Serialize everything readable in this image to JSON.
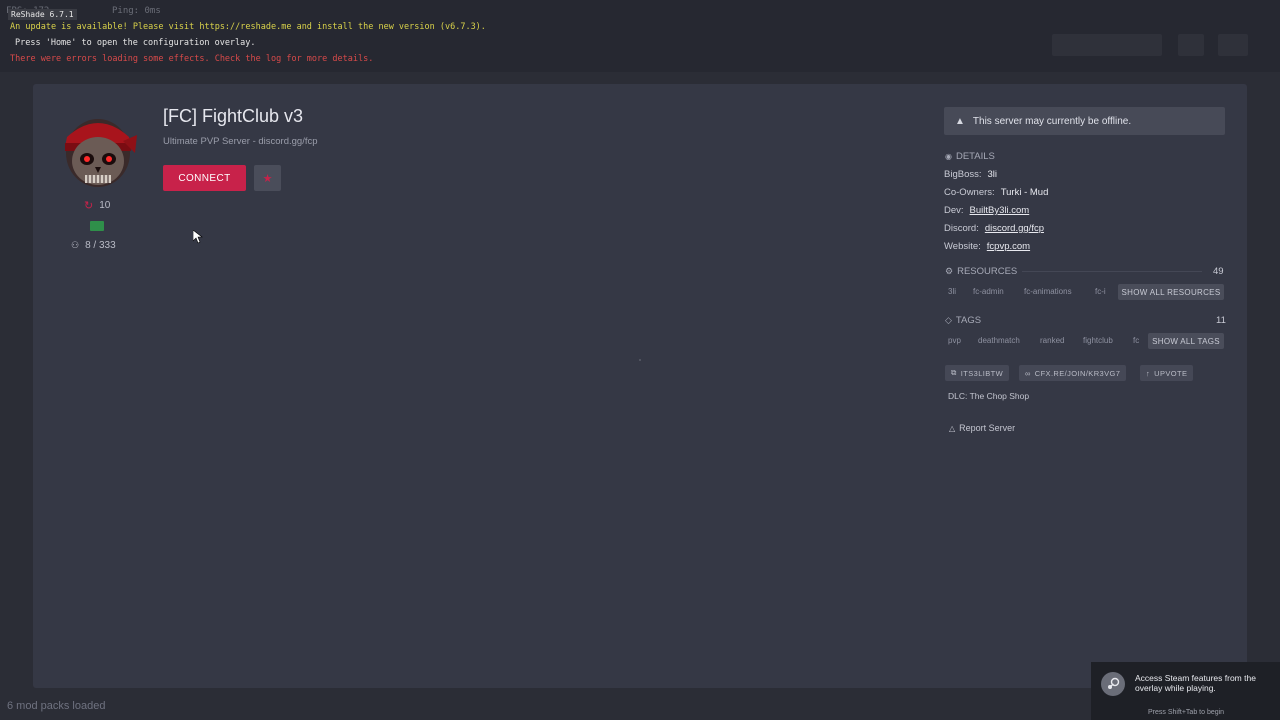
{
  "overlay": {
    "fps": "FPS: 172",
    "ping": "Ping: 0ms",
    "reshade_version": "ReShade 6.7.1",
    "update_notice": "An update is available! Please visit https://reshade.me and install the new version (v6.7.3).",
    "config_hint": "Press 'Home' to open the configuration overlay.",
    "error_notice": "There were errors loading some effects. Check the log for more details.",
    "colors": {
      "update": "#d9d24a",
      "hint": "#e6e6e6",
      "error": "#d84a4a"
    }
  },
  "server": {
    "title": "[FC] FightClub v3",
    "subtitle": "Ultimate PVP Server - discord.gg/fcp",
    "connect_label": "CONNECT",
    "boosts": "10",
    "players": "8 / 333",
    "accent": "#c8224a"
  },
  "status": {
    "offline_message": "This server may currently be offline."
  },
  "details": {
    "heading": "DETAILS",
    "rows": [
      {
        "key": "BigBoss:",
        "value": "3li"
      },
      {
        "key": "Co-Owners:",
        "value": "Turki - Mud"
      },
      {
        "key": "Dev:",
        "value": "BuiltBy3li.com"
      },
      {
        "key": "Discord:",
        "value": "discord.gg/fcp"
      },
      {
        "key": "Website:",
        "value": "fcpvp.com"
      }
    ]
  },
  "resources": {
    "heading": "RESOURCES",
    "count": "49",
    "items": [
      "3li",
      "fc-admin",
      "fc-animations",
      "fc-i"
    ],
    "show_all": "SHOW ALL RESOURCES"
  },
  "tags": {
    "heading": "TAGS",
    "count": "11",
    "items": [
      "pvp",
      "deathmatch",
      "ranked",
      "fightclub",
      "fc"
    ],
    "show_all": "SHOW ALL TAGS"
  },
  "actions": {
    "code": "ITS3LIBTW",
    "join_link": "CFX.RE/JOIN/KR3VG7",
    "upvote": "UPVOTE"
  },
  "dlc": "DLC: The Chop Shop",
  "report": "Report Server",
  "footer": {
    "mods": "6 mod packs loaded"
  },
  "steam": {
    "line1": "Access Steam features from the",
    "line2": "overlay while playing.",
    "hint": "Press Shift+Tab to begin"
  }
}
